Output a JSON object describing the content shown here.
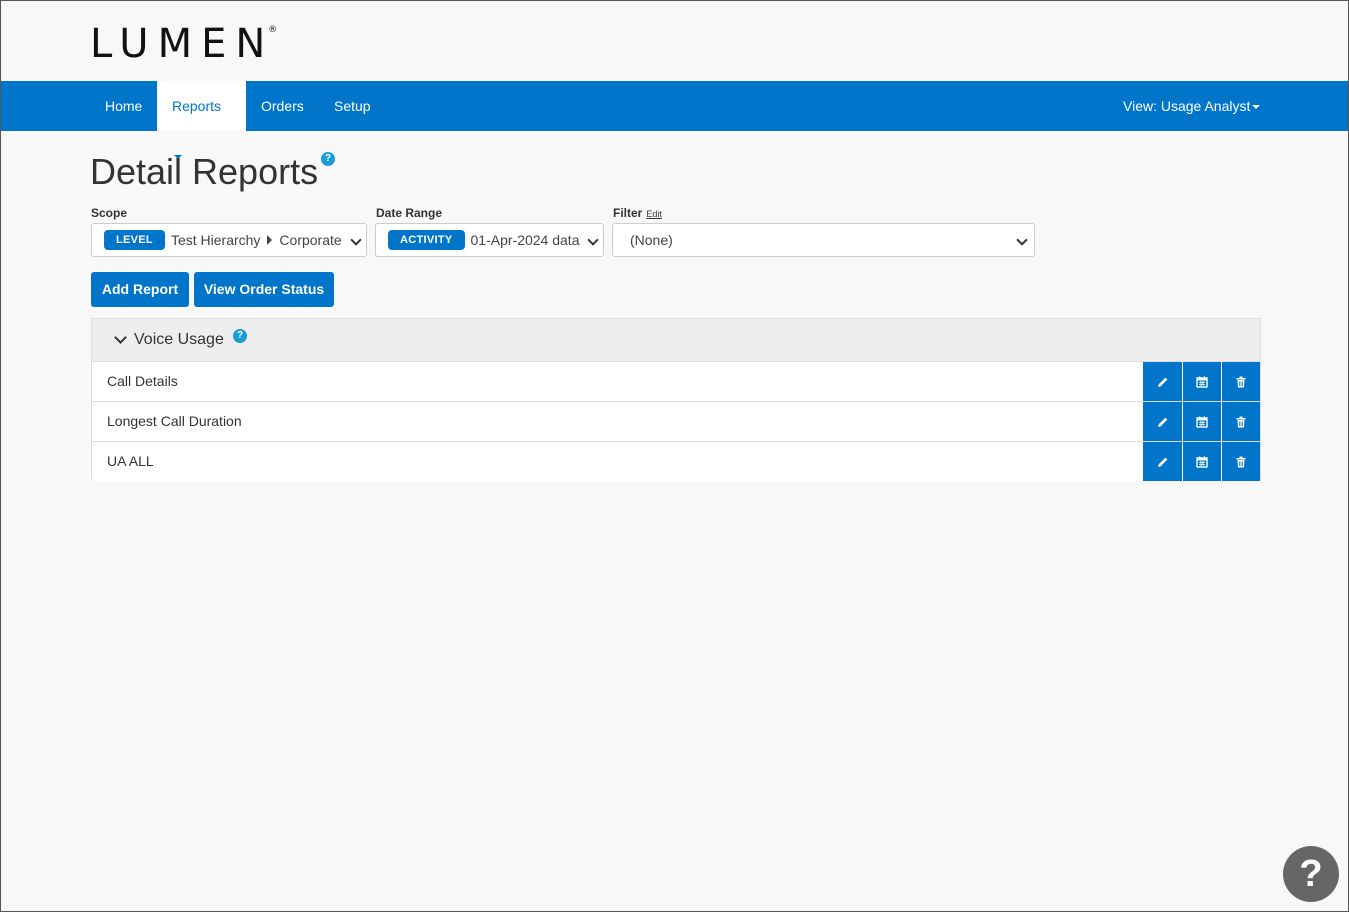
{
  "brand": {
    "name": "LUMEN",
    "mark": "®"
  },
  "nav": {
    "home": "Home",
    "reports": "Reports",
    "orders": "Orders",
    "setup": "Setup",
    "view": "View: Usage Analyst"
  },
  "page": {
    "title": "Detail Reports",
    "help": "?"
  },
  "scope": {
    "label": "Scope",
    "pill": "LEVEL",
    "path_a": "Test Hierarchy",
    "path_b": "Corporate"
  },
  "date_range": {
    "label": "Date Range",
    "pill": "ACTIVITY",
    "value": "01-Apr-2024 data"
  },
  "filter": {
    "label": "Filter",
    "edit": "Edit",
    "value": "(None)"
  },
  "buttons": {
    "add_report": "Add Report",
    "view_order_status": "View Order Status"
  },
  "panel": {
    "title": "Voice Usage",
    "help": "?",
    "rows": [
      {
        "label": "Call Details"
      },
      {
        "label": "Longest Call Duration"
      },
      {
        "label": "UA ALL"
      }
    ]
  },
  "help_fab": "?",
  "colors": {
    "primary": "#0075c9",
    "help": "#1a9bd7",
    "fab": "#666666"
  }
}
